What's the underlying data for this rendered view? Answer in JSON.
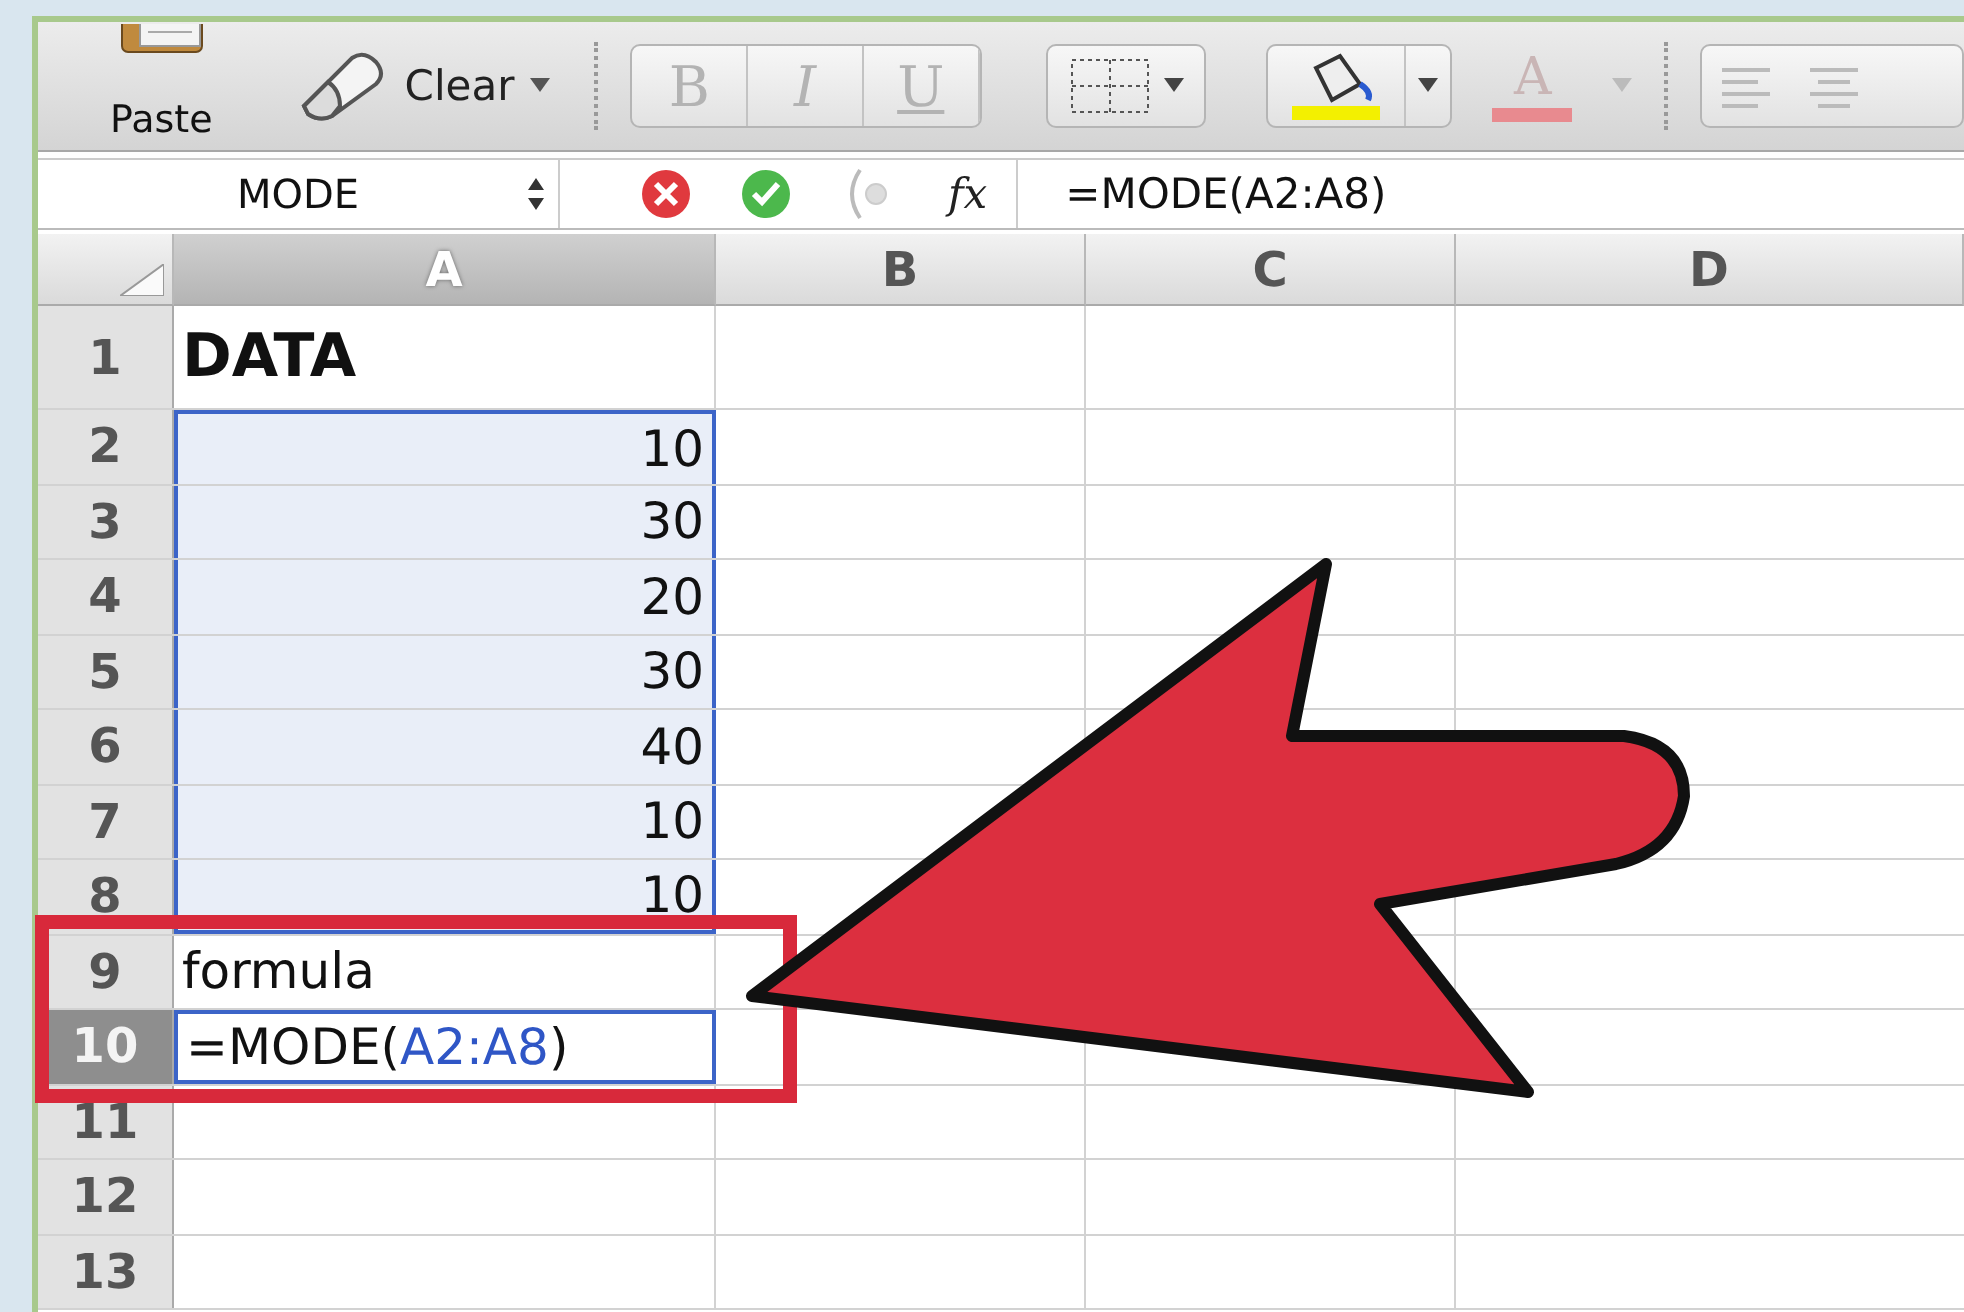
{
  "toolbar": {
    "paste": {
      "label": "Paste"
    },
    "clear": {
      "label": "Clear"
    },
    "format_buttons": [
      {
        "label": "B",
        "disabled": true
      },
      {
        "label": "I",
        "disabled": true
      },
      {
        "label": "U",
        "disabled": true
      }
    ],
    "font_color": {
      "label": "A"
    }
  },
  "formula_bar": {
    "name_box": "MODE",
    "function_label": "fx",
    "formula": "=MODE(A2:A8)"
  },
  "columns": [
    {
      "label": "A",
      "selected": true
    },
    {
      "label": "B",
      "selected": false
    },
    {
      "label": "C",
      "selected": false
    },
    {
      "label": "D",
      "selected": false
    }
  ],
  "rows": [
    {
      "header": "1",
      "selected": false,
      "cells": [
        {
          "kind": "title",
          "value": "DATA",
          "in_range": false,
          "active": false
        }
      ]
    },
    {
      "header": "2",
      "selected": false,
      "cells": [
        {
          "kind": "number",
          "value": "10",
          "in_range": true,
          "active": false
        }
      ]
    },
    {
      "header": "3",
      "selected": false,
      "cells": [
        {
          "kind": "number",
          "value": "30",
          "in_range": true,
          "active": false
        }
      ]
    },
    {
      "header": "4",
      "selected": false,
      "cells": [
        {
          "kind": "number",
          "value": "20",
          "in_range": true,
          "active": false
        }
      ]
    },
    {
      "header": "5",
      "selected": false,
      "cells": [
        {
          "kind": "number",
          "value": "30",
          "in_range": true,
          "active": false
        }
      ]
    },
    {
      "header": "6",
      "selected": false,
      "cells": [
        {
          "kind": "number",
          "value": "40",
          "in_range": true,
          "active": false
        }
      ]
    },
    {
      "header": "7",
      "selected": false,
      "cells": [
        {
          "kind": "number",
          "value": "10",
          "in_range": true,
          "active": false
        }
      ]
    },
    {
      "header": "8",
      "selected": false,
      "cells": [
        {
          "kind": "number",
          "value": "10",
          "in_range": true,
          "active": false
        }
      ]
    },
    {
      "header": "9",
      "selected": false,
      "cells": [
        {
          "kind": "text",
          "value": "formula",
          "in_range": false,
          "active": false
        }
      ]
    },
    {
      "header": "10",
      "selected": true,
      "cells": [
        {
          "kind": "formula",
          "parts": [
            {
              "text": "=MODE(",
              "reference": false
            },
            {
              "text": "A2:A8",
              "reference": true
            },
            {
              "text": ")",
              "reference": false
            }
          ],
          "in_range": false,
          "active": true
        }
      ]
    },
    {
      "header": "11",
      "selected": false
    },
    {
      "header": "12",
      "selected": false
    },
    {
      "header": "13",
      "selected": false
    }
  ],
  "annotations": [
    {
      "kind": "frame"
    },
    {
      "kind": "arrow"
    }
  ]
}
